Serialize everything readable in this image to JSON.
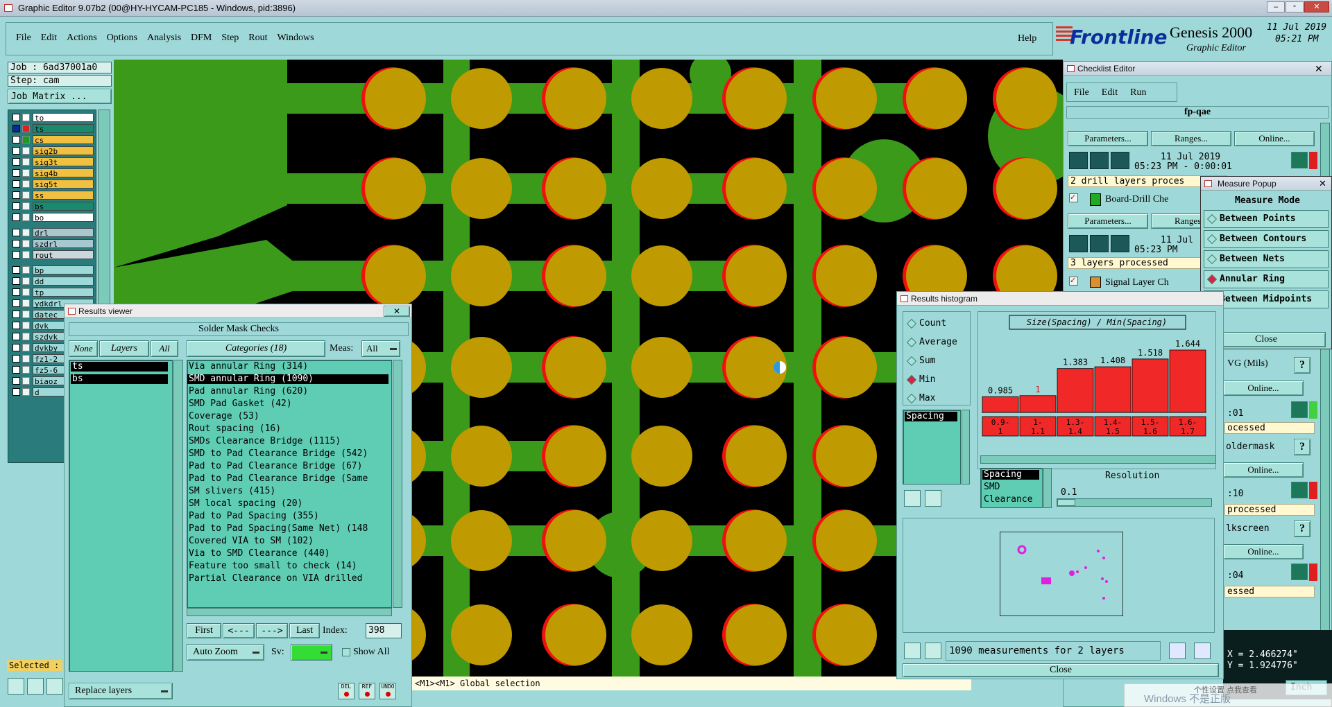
{
  "window": {
    "title": "Graphic Editor 9.07b2 (00@HY-HYCAM-PC185 - Windows, pid:3896)"
  },
  "menu": {
    "items": [
      "File",
      "Edit",
      "Actions",
      "Options",
      "Analysis",
      "DFM",
      "Step",
      "Rout",
      "Windows"
    ],
    "help": "Help"
  },
  "brand": {
    "logo": "Frontline",
    "product": "Genesis 2000",
    "subtitle": "Graphic Editor",
    "date": "11 Jul 2019",
    "time": "05:21 PM"
  },
  "job": {
    "job_label": "Job : 6ad37001a0",
    "step_label": "Step: cam",
    "matrix_button": "Job Matrix ..."
  },
  "layers": [
    {
      "name": "to",
      "color": "#ffffff",
      "box": "#ffffff"
    },
    {
      "name": "ts",
      "color": "#1a8a6e",
      "box": "#e02020",
      "selected": true
    },
    {
      "name": "cs",
      "color": "#f0c040",
      "box": "#1a9a20"
    },
    {
      "name": "sig2b",
      "color": "#f0c040",
      "box": "#eaf7f5"
    },
    {
      "name": "sig3t",
      "color": "#f0c040",
      "box": "#eaf7f5"
    },
    {
      "name": "sig4b",
      "color": "#f0c040",
      "box": "#eaf7f5"
    },
    {
      "name": "sig5t",
      "color": "#f0c040",
      "box": "#eaf7f5"
    },
    {
      "name": "ss",
      "color": "#f0c040",
      "box": "#eaf7f5"
    },
    {
      "name": "bs",
      "color": "#1a8a6e",
      "box": "#eaf7f5"
    },
    {
      "name": "bo",
      "color": "#ffffff",
      "box": "#eaf7f5"
    },
    {
      "name": "drl",
      "color": "#a8c8d0",
      "box": "#eaf7f5"
    },
    {
      "name": "szdrl",
      "color": "#a8c8d0",
      "box": "#eaf7f5"
    },
    {
      "name": "rout",
      "color": "#c8d8dc",
      "box": "#eaf7f5"
    },
    {
      "name": "bp",
      "color": "#9fd8d8",
      "box": "#eaf7f5"
    },
    {
      "name": "dd",
      "color": "#9fd8d8",
      "box": "#eaf7f5"
    },
    {
      "name": "tp",
      "color": "#9fd8d8",
      "box": "#eaf7f5"
    },
    {
      "name": "ydkdrl",
      "color": "#9fd8d8",
      "box": "#eaf7f5"
    },
    {
      "name": "datec",
      "color": "#9fd8d8",
      "box": "#eaf7f5"
    },
    {
      "name": "dvk",
      "color": "#9fd8d8",
      "box": "#eaf7f5"
    },
    {
      "name": "szdvk",
      "color": "#9fd8d8",
      "box": "#eaf7f5"
    },
    {
      "name": "dvkby",
      "color": "#9fd8d8",
      "box": "#eaf7f5"
    },
    {
      "name": "fz1-2",
      "color": "#9fd8d8",
      "box": "#eaf7f5"
    },
    {
      "name": "fz5-6",
      "color": "#9fd8d8",
      "box": "#eaf7f5"
    },
    {
      "name": "biaoz",
      "color": "#9fd8d8",
      "box": "#eaf7f5"
    },
    {
      "name": "d",
      "color": "#9fd8d8",
      "box": "#eaf7f5"
    }
  ],
  "selected_label": "Selected :",
  "status_line": "<M1><M1> Global selection",
  "results_viewer": {
    "title": "Results viewer",
    "heading": "Solder Mask Checks",
    "none": "None",
    "layers_btn": "Layers",
    "all": "All",
    "categories_btn": "Categories (18)",
    "meas_label": "Meas:",
    "meas_value": "All",
    "layer_list": [
      "ts",
      "bs"
    ],
    "categories": [
      "Via annular Ring (314)",
      "SMD annular Ring (1090)",
      "Pad annular Ring (620)",
      "SMD Pad Gasket (42)",
      "Coverage (53)",
      "Rout spacing (16)",
      "SMDs Clearance Bridge (1115)",
      "SMD to Pad Clearance Bridge (542)",
      "Pad to Pad Clearance Bridge (67)",
      "Pad to Pad Clearance Bridge (Same",
      "SM slivers (415)",
      "SM local spacing (20)",
      "Pad to Pad Spacing (355)",
      "Pad to Pad Spacing(Same Net) (148",
      "Covered VIA to SM (102)",
      "Via to SMD Clearance (440)",
      "Feature too small to check (14)",
      "Partial Clearance on VIA drilled"
    ],
    "selected_category": 1,
    "first": "First",
    "prev": "<---",
    "next": "--->",
    "last": "Last",
    "index_label": "Index:",
    "index_value": "398",
    "zoom": "Auto Zoom",
    "sv_label": "Sv:",
    "show_all": "Show All",
    "replace": "Replace layers",
    "mini_labels": [
      "DEL",
      "REF",
      "UNDO"
    ]
  },
  "checklist": {
    "title": "Checklist Editor",
    "menu": [
      "File",
      "Edit",
      "Run"
    ],
    "name": "fp-qae",
    "params": "Parameters...",
    "ranges": "Ranges...",
    "online": "Online...",
    "rows": [
      {
        "date": "11 Jul 2019",
        "time": "05:23 PM - 0:00:01",
        "status": "2 drill layers proces",
        "check": "Board-Drill Che"
      },
      {
        "date": "11 Jul",
        "time": "05:23 PM",
        "status": "3 layers processed",
        "check": "Signal Layer Ch"
      }
    ],
    "right_items": [
      ":01",
      "ocessed",
      "oldermask",
      ":10",
      "processed",
      "lkscreen",
      ":04",
      "essed"
    ],
    "vg": "VG (Mils)",
    "coords": [
      "X = 2.466274\"",
      "Y = 1.924776\""
    ],
    "units": "Inch"
  },
  "measure_popup": {
    "title": "Measure Popup",
    "heading": "Measure Mode",
    "modes": [
      "Between Points",
      "Between Contours",
      "Between Nets",
      "Annular Ring",
      "Between Midpoints"
    ],
    "active": 3,
    "close": "Close"
  },
  "histogram": {
    "title": "Results histogram",
    "stats": [
      "Count",
      "Average",
      "Sum",
      "Min",
      "Max"
    ],
    "active_stat": 3,
    "list": [
      "Spacing"
    ],
    "chart_title": "Size(Spacing) / Min(Spacing)",
    "bins": [
      "0.9-\n1",
      "1-\n1.1",
      "1.3-\n1.4",
      "1.4-\n1.5",
      "1.5-\n1.6",
      "1.6-\n1.7"
    ],
    "values": [
      "0.985",
      "1",
      "1.383",
      "1.408",
      "1.518",
      "1.644"
    ],
    "value_nums": [
      0.985,
      1,
      1.383,
      1.408,
      1.518,
      1.644
    ],
    "type_list": [
      "Spacing",
      "SMD",
      "Clearance"
    ],
    "resolution_label": "Resolution",
    "resolution_value": "0.1",
    "summary": "1090 measurements for 2 layers",
    "close": "Close"
  },
  "footer": {
    "windows_text": "Windows 不是正版",
    "tray_text": "个性设置 点我查看"
  }
}
